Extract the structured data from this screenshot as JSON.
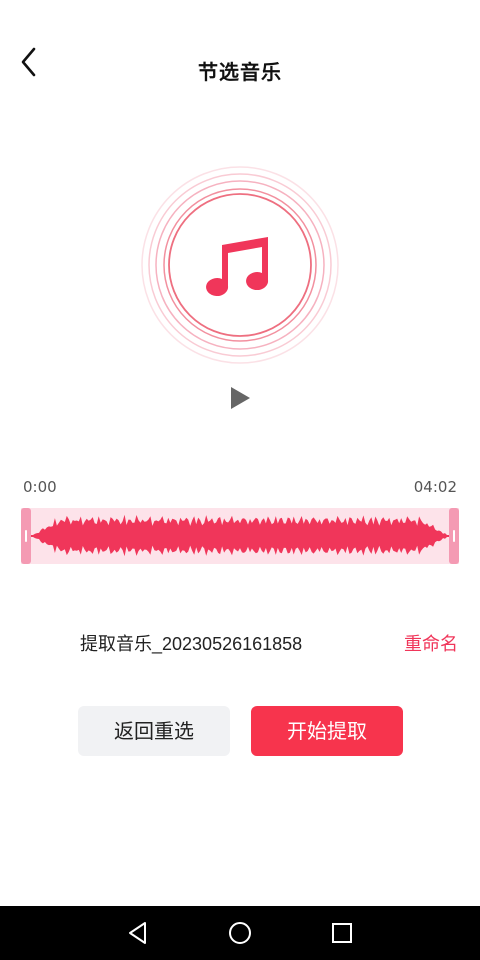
{
  "header": {
    "title": "节选音乐",
    "back_icon": "chevron-left-icon"
  },
  "player": {
    "disc_icon": "music-note-icon",
    "play_icon": "play-icon",
    "accent": "#f0365a"
  },
  "timeline": {
    "start": "0:00",
    "end": "04:02"
  },
  "file": {
    "name": "提取音乐_20230526161858",
    "rename_label": "重命名"
  },
  "actions": {
    "reselect_label": "返回重选",
    "start_label": "开始提取",
    "start_color": "#f7344d"
  },
  "nav": {
    "back": "triangle-back-icon",
    "home": "circle-home-icon",
    "recents": "square-recents-icon"
  }
}
